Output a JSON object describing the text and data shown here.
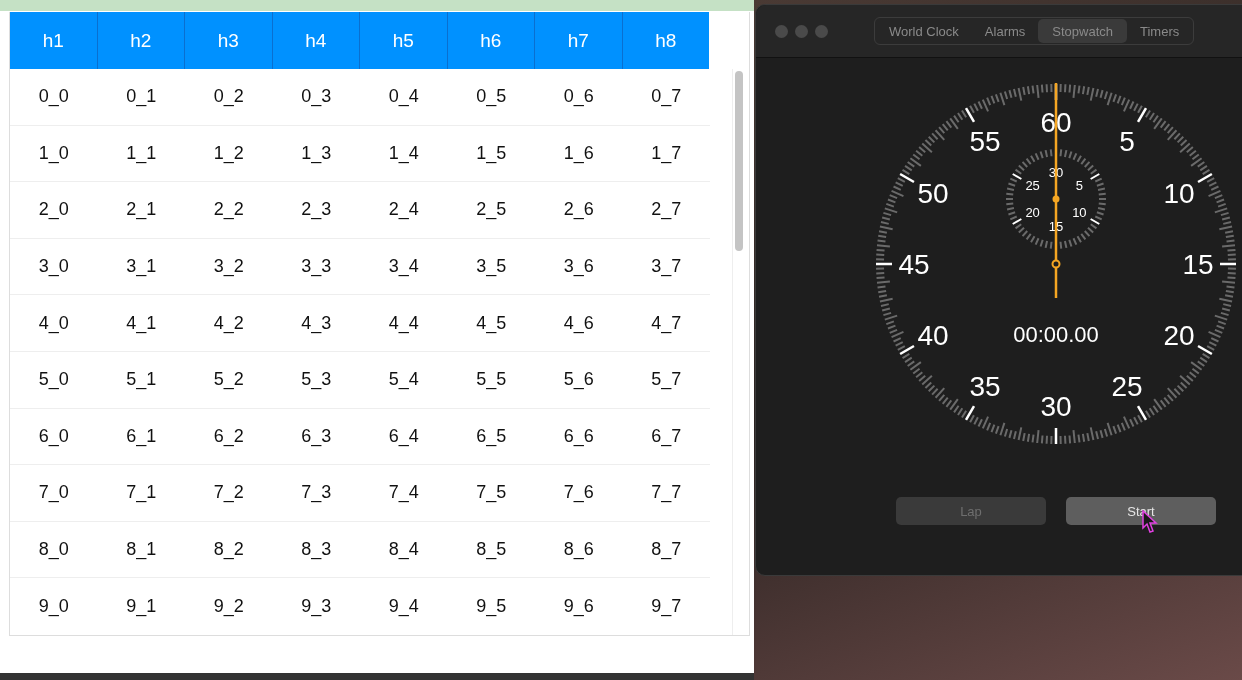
{
  "table": {
    "columns": [
      "h1",
      "h2",
      "h3",
      "h4",
      "h5",
      "h6",
      "h7",
      "h8"
    ],
    "rows": [
      [
        "0_0",
        "0_1",
        "0_2",
        "0_3",
        "0_4",
        "0_5",
        "0_6",
        "0_7"
      ],
      [
        "1_0",
        "1_1",
        "1_2",
        "1_3",
        "1_4",
        "1_5",
        "1_6",
        "1_7"
      ],
      [
        "2_0",
        "2_1",
        "2_2",
        "2_3",
        "2_4",
        "2_5",
        "2_6",
        "2_7"
      ],
      [
        "3_0",
        "3_1",
        "3_2",
        "3_3",
        "3_4",
        "3_5",
        "3_6",
        "3_7"
      ],
      [
        "4_0",
        "4_1",
        "4_2",
        "4_3",
        "4_4",
        "4_5",
        "4_6",
        "4_7"
      ],
      [
        "5_0",
        "5_1",
        "5_2",
        "5_3",
        "5_4",
        "5_5",
        "5_6",
        "5_7"
      ],
      [
        "6_0",
        "6_1",
        "6_2",
        "6_3",
        "6_4",
        "6_5",
        "6_6",
        "6_7"
      ],
      [
        "7_0",
        "7_1",
        "7_2",
        "7_3",
        "7_4",
        "7_5",
        "7_6",
        "7_7"
      ],
      [
        "8_0",
        "8_1",
        "8_2",
        "8_3",
        "8_4",
        "8_5",
        "8_6",
        "8_7"
      ],
      [
        "9_0",
        "9_1",
        "9_2",
        "9_3",
        "9_4",
        "9_5",
        "9_6",
        "9_7"
      ]
    ]
  },
  "clock_window": {
    "tabs": [
      {
        "label": "World Clock",
        "selected": false
      },
      {
        "label": "Alarms",
        "selected": false
      },
      {
        "label": "Stopwatch",
        "selected": true
      },
      {
        "label": "Timers",
        "selected": false
      }
    ],
    "dial_labels": [
      "60",
      "5",
      "10",
      "15",
      "20",
      "25",
      "30",
      "35",
      "40",
      "45",
      "50",
      "55"
    ],
    "subdial_labels": [
      "30",
      "5",
      "10",
      "15",
      "20",
      "25"
    ],
    "readout": "00:00.00",
    "buttons": [
      {
        "label": "Lap",
        "disabled": true
      },
      {
        "label": "Start",
        "disabled": false
      }
    ]
  }
}
